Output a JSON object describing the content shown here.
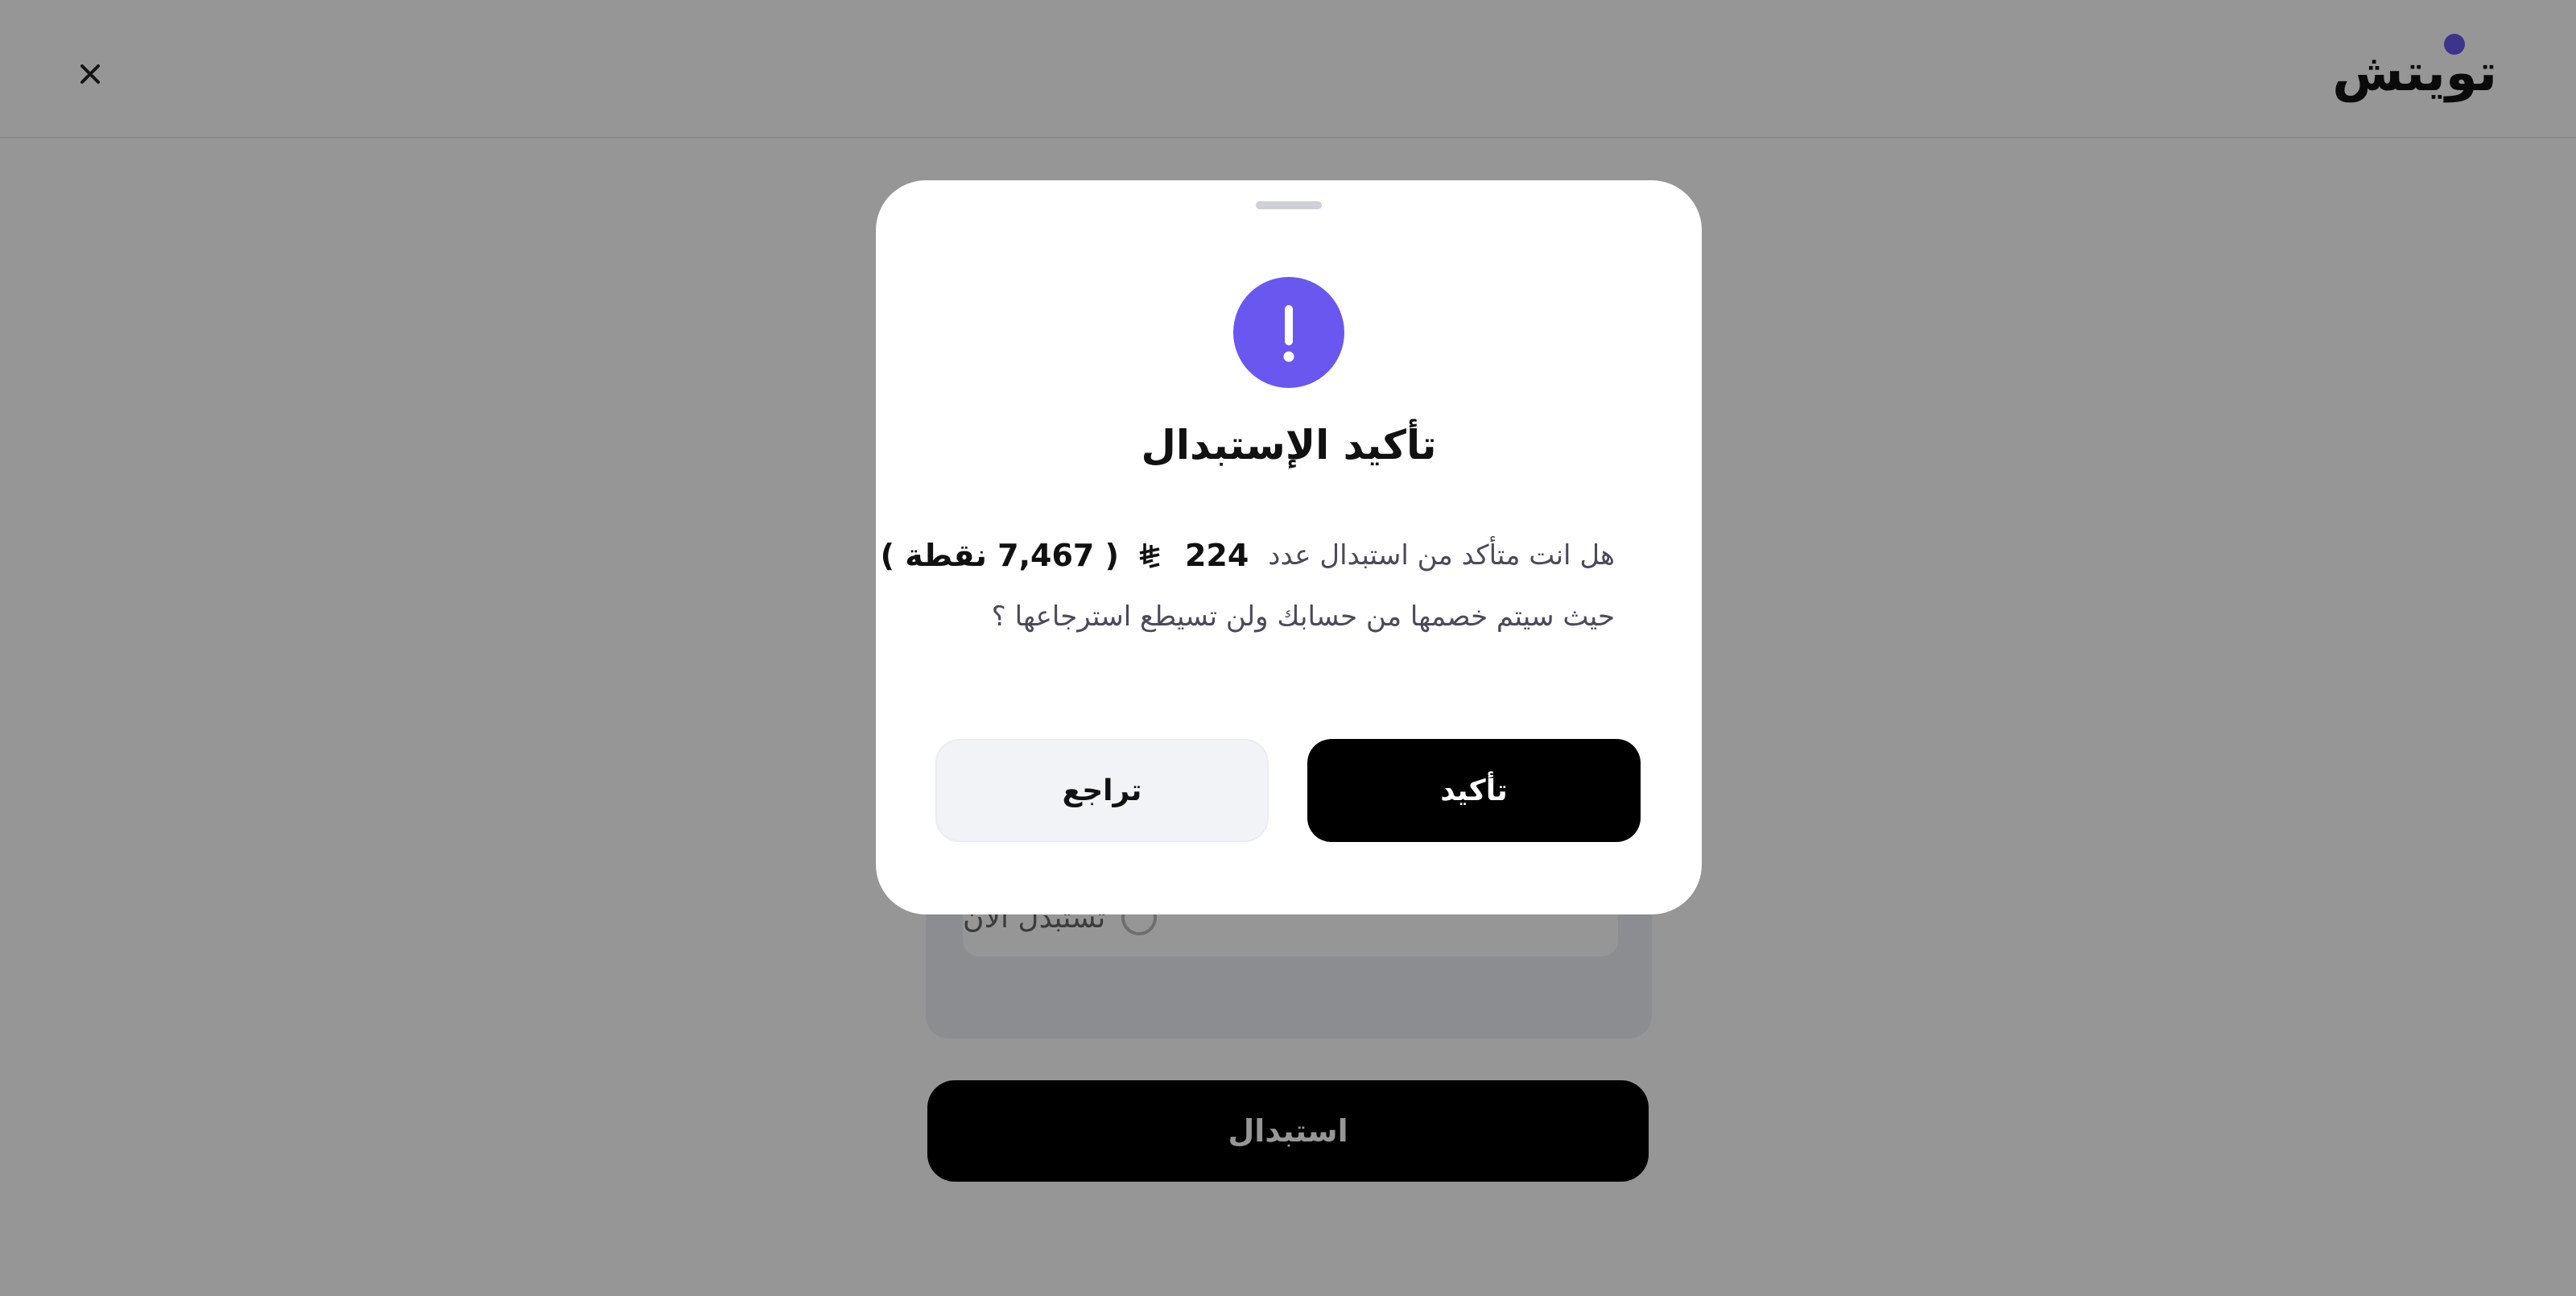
{
  "header": {
    "logo_text": "تويتش",
    "close_icon": "close-icon"
  },
  "background_page": {
    "option_label": "تستبدل الآن",
    "submit_label": "استبدال"
  },
  "modal": {
    "icon": "exclamation-icon",
    "accent_color": "#6a57f0",
    "title": "تأكيد الإستبدال",
    "question_text": "هل انت متأكد من استبدال عدد",
    "amount": "224",
    "currency_icon": "saudi-riyal-icon",
    "points_text": "( 7,467 نقطة )",
    "warning_text": "حيث سيتم خصمها من حسابك ولن تسيطع استرجاعها ؟",
    "confirm_label": "تأكيد",
    "back_label": "تراجع"
  }
}
